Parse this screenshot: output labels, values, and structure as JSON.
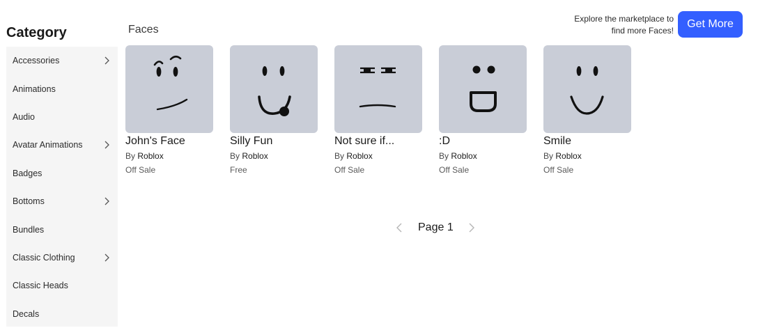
{
  "sidebar": {
    "title": "Category",
    "items": [
      {
        "label": "Accessories",
        "has_submenu": true
      },
      {
        "label": "Animations",
        "has_submenu": false
      },
      {
        "label": "Audio",
        "has_submenu": false
      },
      {
        "label": "Avatar Animations",
        "has_submenu": true
      },
      {
        "label": "Badges",
        "has_submenu": false
      },
      {
        "label": "Bottoms",
        "has_submenu": true
      },
      {
        "label": "Bundles",
        "has_submenu": false
      },
      {
        "label": "Classic Clothing",
        "has_submenu": true
      },
      {
        "label": "Classic Heads",
        "has_submenu": false
      },
      {
        "label": "Decals",
        "has_submenu": false
      }
    ]
  },
  "main": {
    "section_title": "Faces",
    "promo": {
      "line1": "Explore the marketplace to",
      "line2": "find more Faces!",
      "button_label": "Get More"
    },
    "items": [
      {
        "name": "John's Face",
        "by_prefix": "By",
        "creator": "Roblox",
        "price": "Off Sale",
        "icon": "johns-face-icon"
      },
      {
        "name": "Silly Fun",
        "by_prefix": "By",
        "creator": "Roblox",
        "price": "Free",
        "icon": "silly-fun-face-icon"
      },
      {
        "name": "Not sure if...",
        "by_prefix": "By",
        "creator": "Roblox",
        "price": "Off Sale",
        "icon": "not-sure-face-icon"
      },
      {
        "name": ":D",
        "by_prefix": "By",
        "creator": "Roblox",
        "price": "Off Sale",
        "icon": "big-grin-face-icon"
      },
      {
        "name": "Smile",
        "by_prefix": "By",
        "creator": "Roblox",
        "price": "Off Sale",
        "icon": "smile-face-icon"
      }
    ],
    "pagination": {
      "label": "Page 1",
      "prev_icon": "chevron-left-icon",
      "next_icon": "chevron-right-icon"
    }
  },
  "colors": {
    "accent": "#335fff",
    "thumbnail_bg": "#c9cdd7",
    "sidebar_bg": "#f5f5f5"
  }
}
